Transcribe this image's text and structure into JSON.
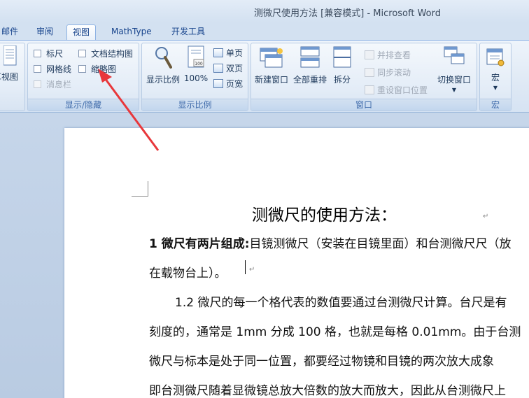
{
  "window": {
    "title": "测微尺使用方法 [兼容模式] - Microsoft Word"
  },
  "tabs": [
    {
      "label": "邮件"
    },
    {
      "label": "审阅"
    },
    {
      "label": "视图",
      "active": true
    },
    {
      "label": "MathType"
    },
    {
      "label": "开发工具"
    }
  ],
  "ribbon": {
    "views_partial": {
      "label": "草视图"
    },
    "show_hide": {
      "group_label": "显示/隐藏",
      "ruler": "标尺",
      "gridlines": "网格线",
      "message_bar": "消息栏",
      "document_map": "文档结构图",
      "thumbnails": "缩略图"
    },
    "zoom": {
      "group_label": "显示比例",
      "zoom_button": "显示比例",
      "percent_button": "100%",
      "percent_icon_text": "100",
      "one_page": "单页",
      "two_pages": "双页",
      "page_width": "页宽"
    },
    "window": {
      "group_label": "窗口",
      "new_window": "新建窗口",
      "arrange_all": "全部重排",
      "split": "拆分",
      "view_side_by_side": "并排查看",
      "sync_scrolling": "同步滚动",
      "reset_window_position": "重设窗口位置",
      "switch_windows": "切换窗口"
    },
    "macros": {
      "group_label": "宏",
      "macros_button": "宏"
    }
  },
  "document": {
    "heading": "测微尺的使用方法：",
    "para1_bold": "1 微尺有两片组成:",
    "para1_text": "目镜测微尺（安装在目镜里面）和台测微尺尺（放",
    "para1_line2": "在载物台上）。",
    "para2_line1": "1.2 微尺的每一个格代表的数值要通过台测微尺计算。台尺是有",
    "para2_line2": "刻度的，通常是 1mm 分成 100 格，也就是每格 0.01mm。由于台测",
    "para2_line3": "微尺与标本是处于同一位置，都要经过物镜和目镜的两次放大成象",
    "para2_line4": "即台测微尺随着显微镜总放大倍数的放大而放大，因此从台测微尺上"
  },
  "colors": {
    "ribbon_text": "#1e395b",
    "group_label": "#3e6aaa",
    "annotation_arrow": "#e8373b"
  }
}
